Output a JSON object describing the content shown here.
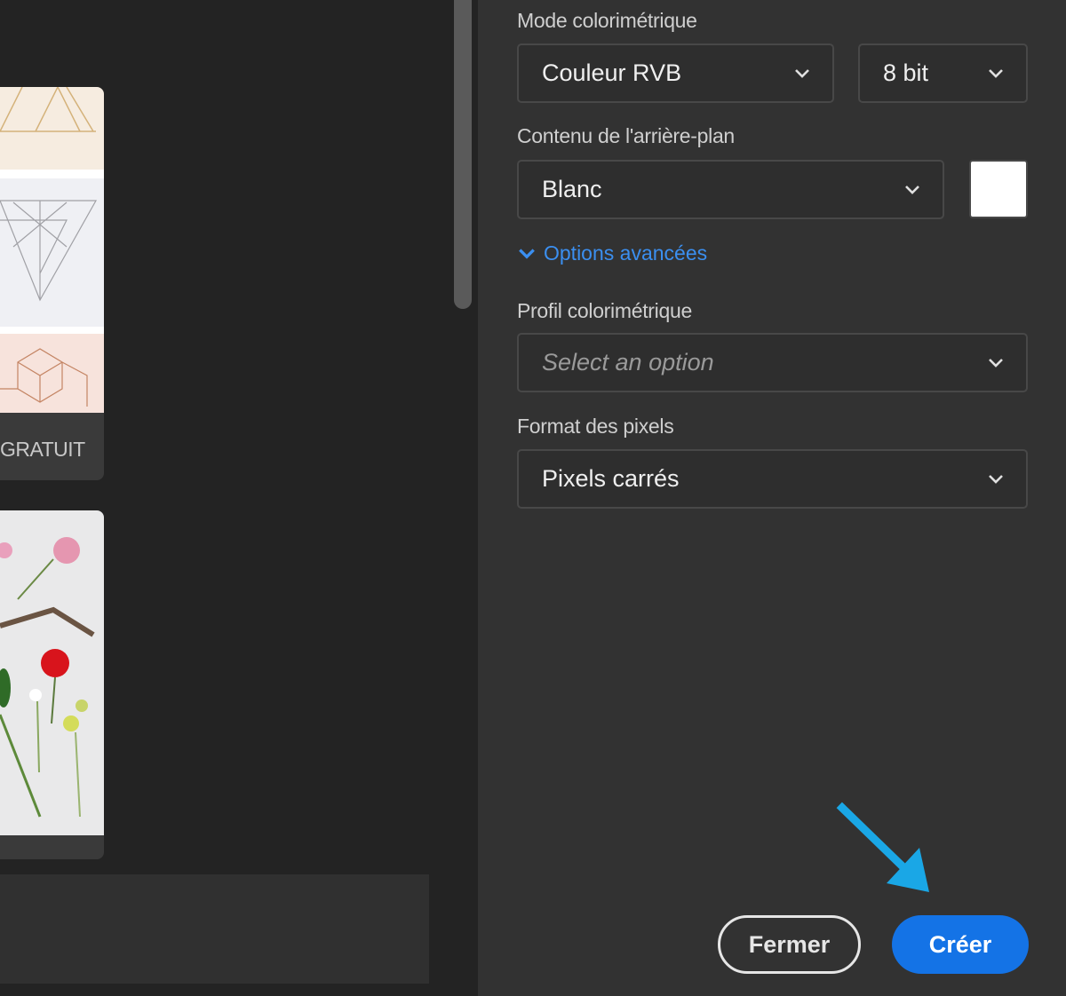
{
  "gallery": {
    "cards": [
      {
        "label": "GRATUIT"
      }
    ]
  },
  "panel": {
    "color_mode": {
      "label": "Mode colorimétrique",
      "value": "Couleur RVB",
      "bit_depth": "8 bit"
    },
    "background": {
      "label": "Contenu de l'arrière-plan",
      "value": "Blanc",
      "swatch_color": "#ffffff"
    },
    "advanced_toggle": "Options avancées",
    "color_profile": {
      "label": "Profil colorimétrique",
      "placeholder": "Select an option"
    },
    "pixel_format": {
      "label": "Format des pixels",
      "value": "Pixels carrés"
    },
    "buttons": {
      "close": "Fermer",
      "create": "Créer"
    }
  },
  "colors": {
    "accent": "#1473e6",
    "link": "#3b8ff0",
    "annotation_arrow": "#1aa7e6"
  },
  "icons": [
    "chevron-down-icon",
    "arrow-annotation"
  ]
}
